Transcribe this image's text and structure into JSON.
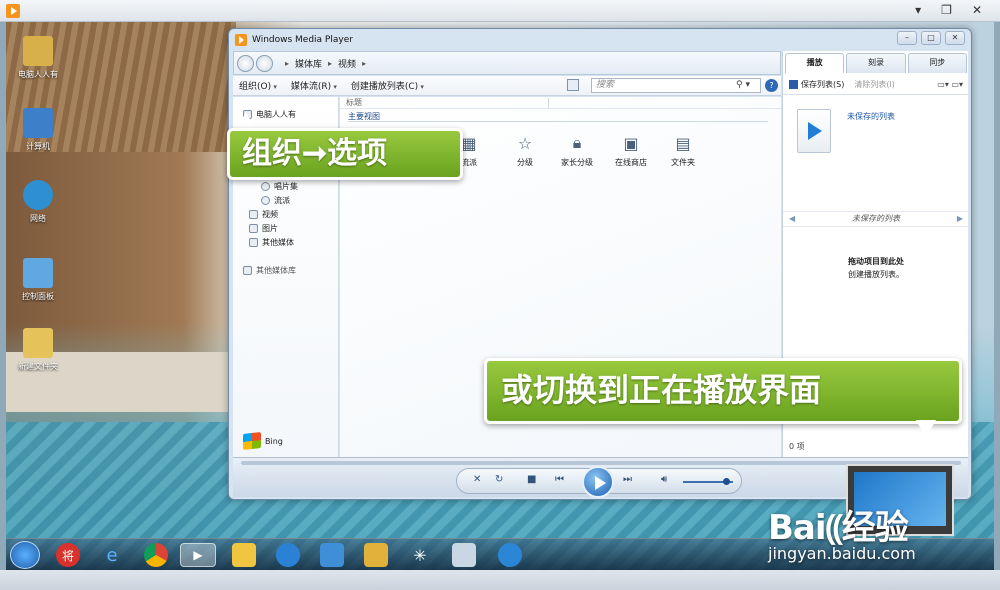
{
  "outer": {
    "controls": [
      "▾",
      "❐",
      "✕"
    ]
  },
  "desktop_icons": [
    {
      "label": "电脑人人有",
      "color": "#d8b04a"
    },
    {
      "label": "计算机",
      "color": "#3d7fc9"
    },
    {
      "label": "网络",
      "color": "#2e8fd1"
    },
    {
      "label": "控制面板",
      "color": "#5fa8e0"
    },
    {
      "label": "新建文件夹",
      "color": "#e6c35a"
    }
  ],
  "wmp": {
    "title": "Windows Media Player",
    "window_buttons": [
      "–",
      "□",
      "✕"
    ],
    "breadcrumb": [
      "媒体库",
      "视频"
    ],
    "toolbar": {
      "organize": "组织(O)",
      "stream": "媒体流(R)",
      "create_playlist": "创建播放列表(C)"
    },
    "search": {
      "placeholder": "搜索",
      "icon": "search-icon"
    },
    "nav": {
      "library": "电脑人人有",
      "sub_items": [
        "唱片集",
        "流派"
      ],
      "items": [
        "视频",
        "图片",
        "其他媒体"
      ],
      "other": "其他媒体库",
      "bing": "Bing"
    },
    "content": {
      "column_header": "标题",
      "main_view": "主要视图",
      "tiles": [
        {
          "label": "流派",
          "icon": "genre-icon"
        },
        {
          "label": "分级",
          "icon": "star-icon"
        },
        {
          "label": "家长分级",
          "icon": "lock-icon"
        },
        {
          "label": "在线商店",
          "icon": "store-icon"
        },
        {
          "label": "文件夹",
          "icon": "folder-icon"
        }
      ]
    },
    "right_pane": {
      "tabs": [
        "播放",
        "刻录",
        "同步"
      ],
      "active_tab": 0,
      "save_list": "保存列表(S)",
      "clear_list": "清除列表(I)",
      "unsaved_top": "未保存的列表",
      "unsaved_nav": "未保存的列表",
      "drag_title": "拖动项目到此处",
      "drag_sub": "创建播放列表。",
      "count": "0 项"
    },
    "player": {
      "volume_level": 0.8
    }
  },
  "callouts": {
    "organize_options": "组织➞选项",
    "switch_view": "或切换到正在播放界面"
  },
  "watermark": {
    "brand": "Bai⸨经验",
    "url": "jingyan.baidu.com"
  }
}
